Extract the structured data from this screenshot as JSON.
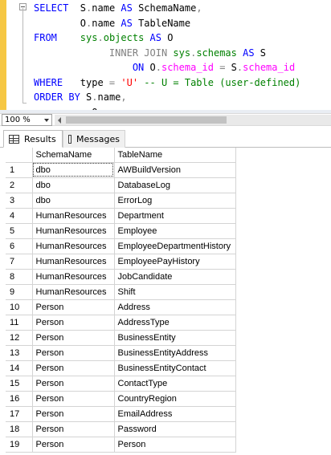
{
  "editor": {
    "lines": [
      [
        [
          "kw",
          "SELECT  "
        ],
        [
          "id",
          "S"
        ],
        [
          "op",
          "."
        ],
        [
          "id",
          "name "
        ],
        [
          "kw",
          "AS "
        ],
        [
          "id",
          "SchemaName"
        ],
        [
          "op",
          ","
        ]
      ],
      [
        [
          "id",
          "        O"
        ],
        [
          "op",
          "."
        ],
        [
          "id",
          "name "
        ],
        [
          "kw",
          "AS "
        ],
        [
          "id",
          "TableName"
        ]
      ],
      [
        [
          "kw",
          "FROM    "
        ],
        [
          "sys",
          "sys"
        ],
        [
          "op",
          "."
        ],
        [
          "sys",
          "objects "
        ],
        [
          "kw",
          "AS "
        ],
        [
          "id",
          "O"
        ]
      ],
      [
        [
          "op",
          "             INNER JOIN "
        ],
        [
          "sys",
          "sys"
        ],
        [
          "op",
          "."
        ],
        [
          "sys",
          "schemas "
        ],
        [
          "kw",
          "AS "
        ],
        [
          "id",
          "S"
        ]
      ],
      [
        [
          "kw",
          "                 ON "
        ],
        [
          "id",
          "O"
        ],
        [
          "op",
          "."
        ],
        [
          "fn",
          "schema_id "
        ],
        [
          "op",
          "= "
        ],
        [
          "id",
          "S"
        ],
        [
          "op",
          "."
        ],
        [
          "fn",
          "schema_id"
        ]
      ],
      [
        [
          "kw",
          "WHERE   "
        ],
        [
          "id",
          "type "
        ],
        [
          "op",
          "= "
        ],
        [
          "str",
          "'U'"
        ],
        [
          "cm",
          " -- U = Table (user-defined)"
        ]
      ],
      [
        [
          "kw",
          "ORDER BY "
        ],
        [
          "id",
          "S"
        ],
        [
          "op",
          "."
        ],
        [
          "id",
          "name"
        ],
        [
          "op",
          ","
        ]
      ],
      [
        [
          "id",
          "          O"
        ],
        [
          "op",
          "."
        ],
        [
          "id",
          "name"
        ],
        [
          "op",
          ";"
        ]
      ]
    ]
  },
  "zoom": {
    "value": "100 %"
  },
  "tabs": {
    "results_label": "Results",
    "messages_label": "Messages"
  },
  "results": {
    "columns": [
      "SchemaName",
      "TableName"
    ],
    "rows": [
      [
        "1",
        "dbo",
        "AWBuildVersion"
      ],
      [
        "2",
        "dbo",
        "DatabaseLog"
      ],
      [
        "3",
        "dbo",
        "ErrorLog"
      ],
      [
        "4",
        "HumanResources",
        "Department"
      ],
      [
        "5",
        "HumanResources",
        "Employee"
      ],
      [
        "6",
        "HumanResources",
        "EmployeeDepartmentHistory"
      ],
      [
        "7",
        "HumanResources",
        "EmployeePayHistory"
      ],
      [
        "8",
        "HumanResources",
        "JobCandidate"
      ],
      [
        "9",
        "HumanResources",
        "Shift"
      ],
      [
        "10",
        "Person",
        "Address"
      ],
      [
        "11",
        "Person",
        "AddressType"
      ],
      [
        "12",
        "Person",
        "BusinessEntity"
      ],
      [
        "13",
        "Person",
        "BusinessEntityAddress"
      ],
      [
        "14",
        "Person",
        "BusinessEntityContact"
      ],
      [
        "15",
        "Person",
        "ContactType"
      ],
      [
        "16",
        "Person",
        "CountryRegion"
      ],
      [
        "17",
        "Person",
        "EmailAddress"
      ],
      [
        "18",
        "Person",
        "Password"
      ],
      [
        "19",
        "Person",
        "Person"
      ]
    ]
  }
}
